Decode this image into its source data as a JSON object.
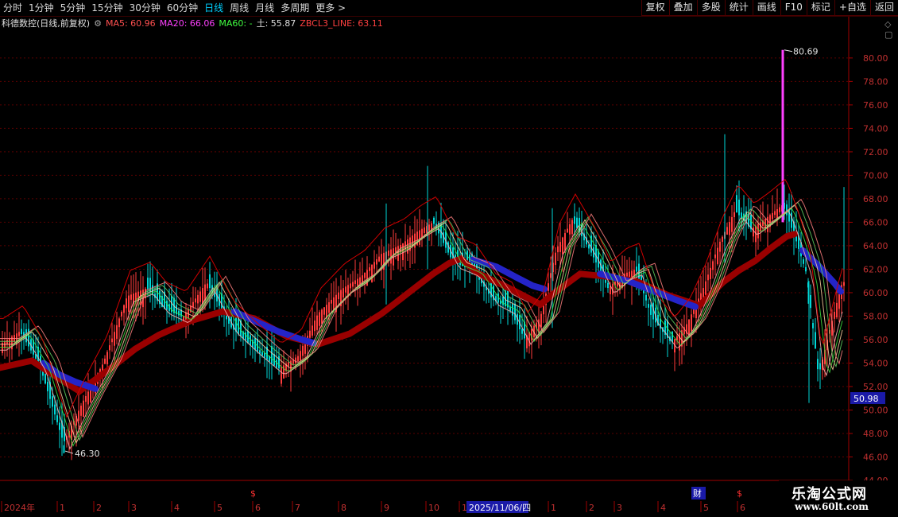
{
  "toolbar": {
    "tabs": [
      "分时",
      "1分钟",
      "5分钟",
      "15分钟",
      "30分钟",
      "60分钟",
      "日线",
      "周线",
      "月线",
      "多周期",
      "更多 >"
    ],
    "active_tab": "日线",
    "right_buttons": [
      "复权",
      "叠加",
      "多股",
      "统计",
      "画线",
      "F10",
      "标记",
      "+自选",
      "返回"
    ]
  },
  "info": {
    "stock_name": "科德数控(日线,前复权)",
    "ma5": "MA5: 60.96",
    "ma20": "MA20: 66.06",
    "ma60": "MA60: -",
    "earth": "土: 55.87",
    "zbcl": "ZBCL3_LINE: 63.11"
  },
  "colors": {
    "up": "#ff3c3c",
    "down": "#00e0e0",
    "ma5": "#ff6060",
    "ma20": "#ff40ff",
    "ma60": "#40ff40",
    "red_band": "#a00000",
    "blue_band": "#2020c8",
    "axis": "#a00000"
  },
  "watermark": {
    "line1": "乐淘公式网",
    "line2": "www.60lt.com"
  },
  "markers": {
    "stock_event": "$",
    "finance": "财"
  },
  "chart_data": {
    "type": "candlestick",
    "title": "科德数控(日线,前复权)",
    "y_axis": {
      "ticks": [
        44.0,
        46.0,
        48.0,
        50.0,
        52.0,
        54.0,
        56.0,
        58.0,
        60.0,
        62.0,
        64.0,
        66.0,
        68.0,
        70.0,
        72.0,
        74.0,
        76.0,
        78.0,
        80.0
      ],
      "range": [
        44.0,
        82.5
      ]
    },
    "price_label": "50.98",
    "high_label": "80.69",
    "low_label": "46.30",
    "x_labels": [
      "2024年",
      "1",
      "2",
      "3",
      "4",
      "5",
      "6",
      "7",
      "8",
      "9",
      "10",
      "11",
      "12",
      "1",
      "2",
      "3",
      "4",
      "5",
      "6"
    ],
    "selected_date": "2025/11/06/四",
    "series": [
      {
        "name": "MA5",
        "values": []
      },
      {
        "name": "MA20",
        "values": []
      }
    ],
    "close_path": [
      [
        0,
        55.6
      ],
      [
        25,
        56.7
      ],
      [
        50,
        53.8
      ],
      [
        80,
        47.2
      ],
      [
        105,
        50.8
      ],
      [
        130,
        54.0
      ],
      [
        160,
        59.7
      ],
      [
        185,
        60.4
      ],
      [
        205,
        58.7
      ],
      [
        230,
        57.9
      ],
      [
        260,
        60.9
      ],
      [
        290,
        57.1
      ],
      [
        320,
        55.2
      ],
      [
        350,
        53.5
      ],
      [
        375,
        54.6
      ],
      [
        400,
        58.2
      ],
      [
        430,
        60.3
      ],
      [
        455,
        61.4
      ],
      [
        480,
        63.3
      ],
      [
        505,
        64.1
      ],
      [
        525,
        65.2
      ],
      [
        545,
        66.0
      ],
      [
        570,
        62.6
      ],
      [
        595,
        61.9
      ],
      [
        620,
        59.4
      ],
      [
        640,
        58.7
      ],
      [
        660,
        56.1
      ],
      [
        680,
        57.9
      ],
      [
        700,
        63.7
      ],
      [
        720,
        66.2
      ],
      [
        745,
        63.3
      ],
      [
        765,
        60.4
      ],
      [
        785,
        61.6
      ],
      [
        800,
        62.0
      ],
      [
        820,
        57.9
      ],
      [
        845,
        55.7
      ],
      [
        865,
        57.4
      ],
      [
        885,
        60.4
      ],
      [
        905,
        64.2
      ],
      [
        925,
        67.0
      ],
      [
        945,
        65.4
      ],
      [
        965,
        66.4
      ],
      [
        985,
        67.5
      ],
      [
        1000,
        64.8
      ],
      [
        1015,
        61.6
      ],
      [
        1030,
        52.9
      ],
      [
        1045,
        57.1
      ],
      [
        1060,
        60.9
      ]
    ],
    "spikes": [
      {
        "x": 985,
        "high": 80.69,
        "low": 66.0
      },
      {
        "x": 912,
        "high": 73.5,
        "low": 62.5
      },
      {
        "x": 538,
        "high": 70.8,
        "low": 62.0
      },
      {
        "x": 486,
        "high": 67.6,
        "low": 59.0
      },
      {
        "x": 695,
        "high": 67.2,
        "low": 57.0
      },
      {
        "x": 80,
        "high": 47.0,
        "low": 46.3
      },
      {
        "x": 1018,
        "high": 61.0,
        "low": 50.6
      },
      {
        "x": 1062,
        "high": 69.0,
        "low": 62.0
      }
    ],
    "red_band_path": [
      [
        0,
        53.6
      ],
      [
        40,
        54.2
      ],
      [
        60,
        53.3
      ],
      [
        100,
        51.6
      ],
      [
        140,
        53.6
      ],
      [
        170,
        55.2
      ],
      [
        200,
        56.4
      ],
      [
        240,
        57.6
      ],
      [
        280,
        58.4
      ],
      [
        320,
        57.8
      ],
      [
        360,
        56.3
      ],
      [
        400,
        55.6
      ],
      [
        440,
        56.5
      ],
      [
        480,
        58.2
      ],
      [
        520,
        60.3
      ],
      [
        545,
        61.6
      ],
      [
        565,
        62.5
      ],
      [
        580,
        62.9
      ],
      [
        600,
        61.7
      ],
      [
        640,
        60.4
      ],
      [
        680,
        59.0
      ],
      [
        700,
        60.1
      ],
      [
        730,
        61.6
      ],
      [
        760,
        61.4
      ],
      [
        800,
        61.0
      ],
      [
        840,
        59.8
      ],
      [
        880,
        58.9
      ],
      [
        910,
        60.9
      ],
      [
        930,
        61.9
      ],
      [
        950,
        62.7
      ],
      [
        970,
        63.8
      ],
      [
        990,
        64.8
      ],
      [
        1000,
        65.0
      ]
    ],
    "blue_band_path": [
      [
        55,
        54.0
      ],
      [
        75,
        53.0
      ],
      [
        95,
        52.4
      ],
      [
        120,
        51.8
      ],
      [
        295,
        58.4
      ],
      [
        320,
        57.6
      ],
      [
        350,
        56.7
      ],
      [
        380,
        56.0
      ],
      [
        395,
        55.7
      ],
      [
        595,
        62.8
      ],
      [
        625,
        62.2
      ],
      [
        650,
        61.3
      ],
      [
        670,
        60.6
      ],
      [
        685,
        60.3
      ],
      [
        755,
        61.6
      ],
      [
        790,
        61.0
      ],
      [
        820,
        60.2
      ],
      [
        850,
        59.4
      ],
      [
        875,
        58.8
      ],
      [
        1010,
        63.6
      ],
      [
        1030,
        62.3
      ],
      [
        1050,
        60.8
      ],
      [
        1058,
        60.1
      ]
    ]
  }
}
